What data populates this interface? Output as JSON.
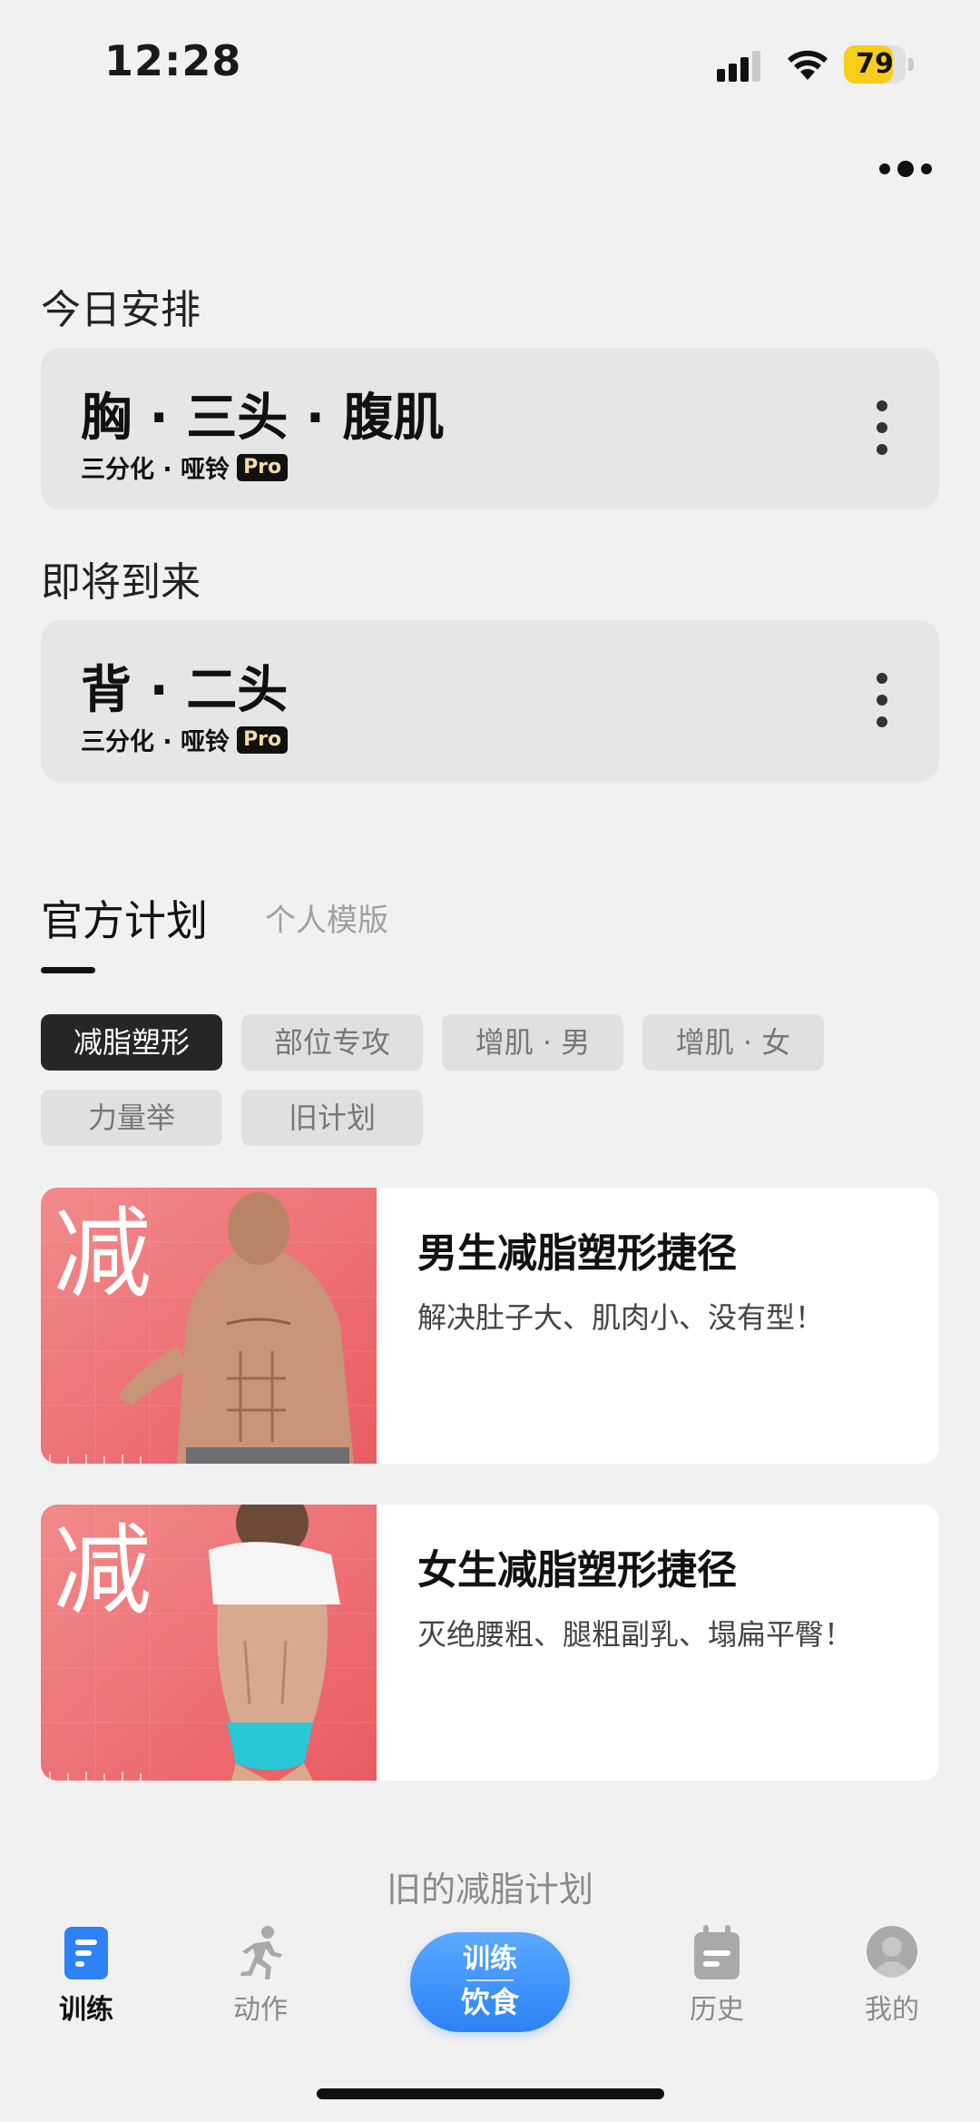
{
  "status_bar": {
    "time": "12:28",
    "battery": "79",
    "battery_level": 0.79
  },
  "today": {
    "section_title": "今日安排",
    "plan_name": "胸 · 三头 · 腹肌",
    "plan_sub": "三分化 · 哑铃",
    "badge": "Pro"
  },
  "upcoming": {
    "section_title": "即将到来",
    "plan_name": "背 · 二头",
    "plan_sub": "三分化 · 哑铃",
    "badge": "Pro"
  },
  "tabs": {
    "official": "官方计划",
    "personal": "个人模版"
  },
  "chips": [
    {
      "label": "减脂塑形",
      "active": true
    },
    {
      "label": "部位专攻",
      "active": false
    },
    {
      "label": "增肌 · 男",
      "active": false
    },
    {
      "label": "增肌 · 女",
      "active": false
    },
    {
      "label": "力量举",
      "active": false
    },
    {
      "label": "旧计划",
      "active": false
    }
  ],
  "promos": [
    {
      "image_text": "减",
      "title": "男生减脂塑形捷径",
      "desc": "解决肚子大、肌肉小、没有型！"
    },
    {
      "image_text": "减",
      "title": "女生减脂塑形捷径",
      "desc": "灭绝腰粗、腿粗副乳、塌扁平臀！"
    }
  ],
  "old_plans_link": "旧的减脂计划",
  "tab_bar": {
    "train": "训练",
    "actions": "动作",
    "center_top": "训练",
    "center_bottom": "饮食",
    "history": "历史",
    "mine": "我的"
  },
  "colors": {
    "accent": "#2c82f6",
    "pro_badge": "#111111",
    "promo_bg": "#f06b6b",
    "battery": "#f7cd1c"
  }
}
